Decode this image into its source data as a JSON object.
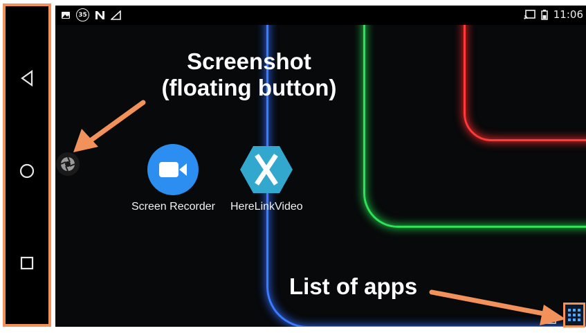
{
  "status_bar": {
    "notification_count": "35",
    "time": "11:06",
    "left_icons": [
      "image-icon",
      "badge-35-icon",
      "n-icon",
      "signal-icon"
    ],
    "right_icons": [
      "cast-icon",
      "battery-icon"
    ]
  },
  "nav_bar": {
    "items": [
      {
        "name": "back-icon"
      },
      {
        "name": "home-icon"
      },
      {
        "name": "recents-icon"
      }
    ]
  },
  "apps": [
    {
      "label": "Screen Recorder",
      "icon": "video-camera-icon",
      "color": "#2b8ef0"
    },
    {
      "label": "HereLinkVideo",
      "icon": "xamarin-x-icon",
      "color": "#33a8cf"
    }
  ],
  "annotations": {
    "screenshot_title": "Screenshot",
    "screenshot_sub": "(floating button)",
    "apps_list": "List of apps"
  },
  "colors": {
    "annotation_orange": "#f2915a",
    "neon_blue": "#2e6bff",
    "neon_green": "#22d34a",
    "neon_red": "#ff2a2a"
  }
}
